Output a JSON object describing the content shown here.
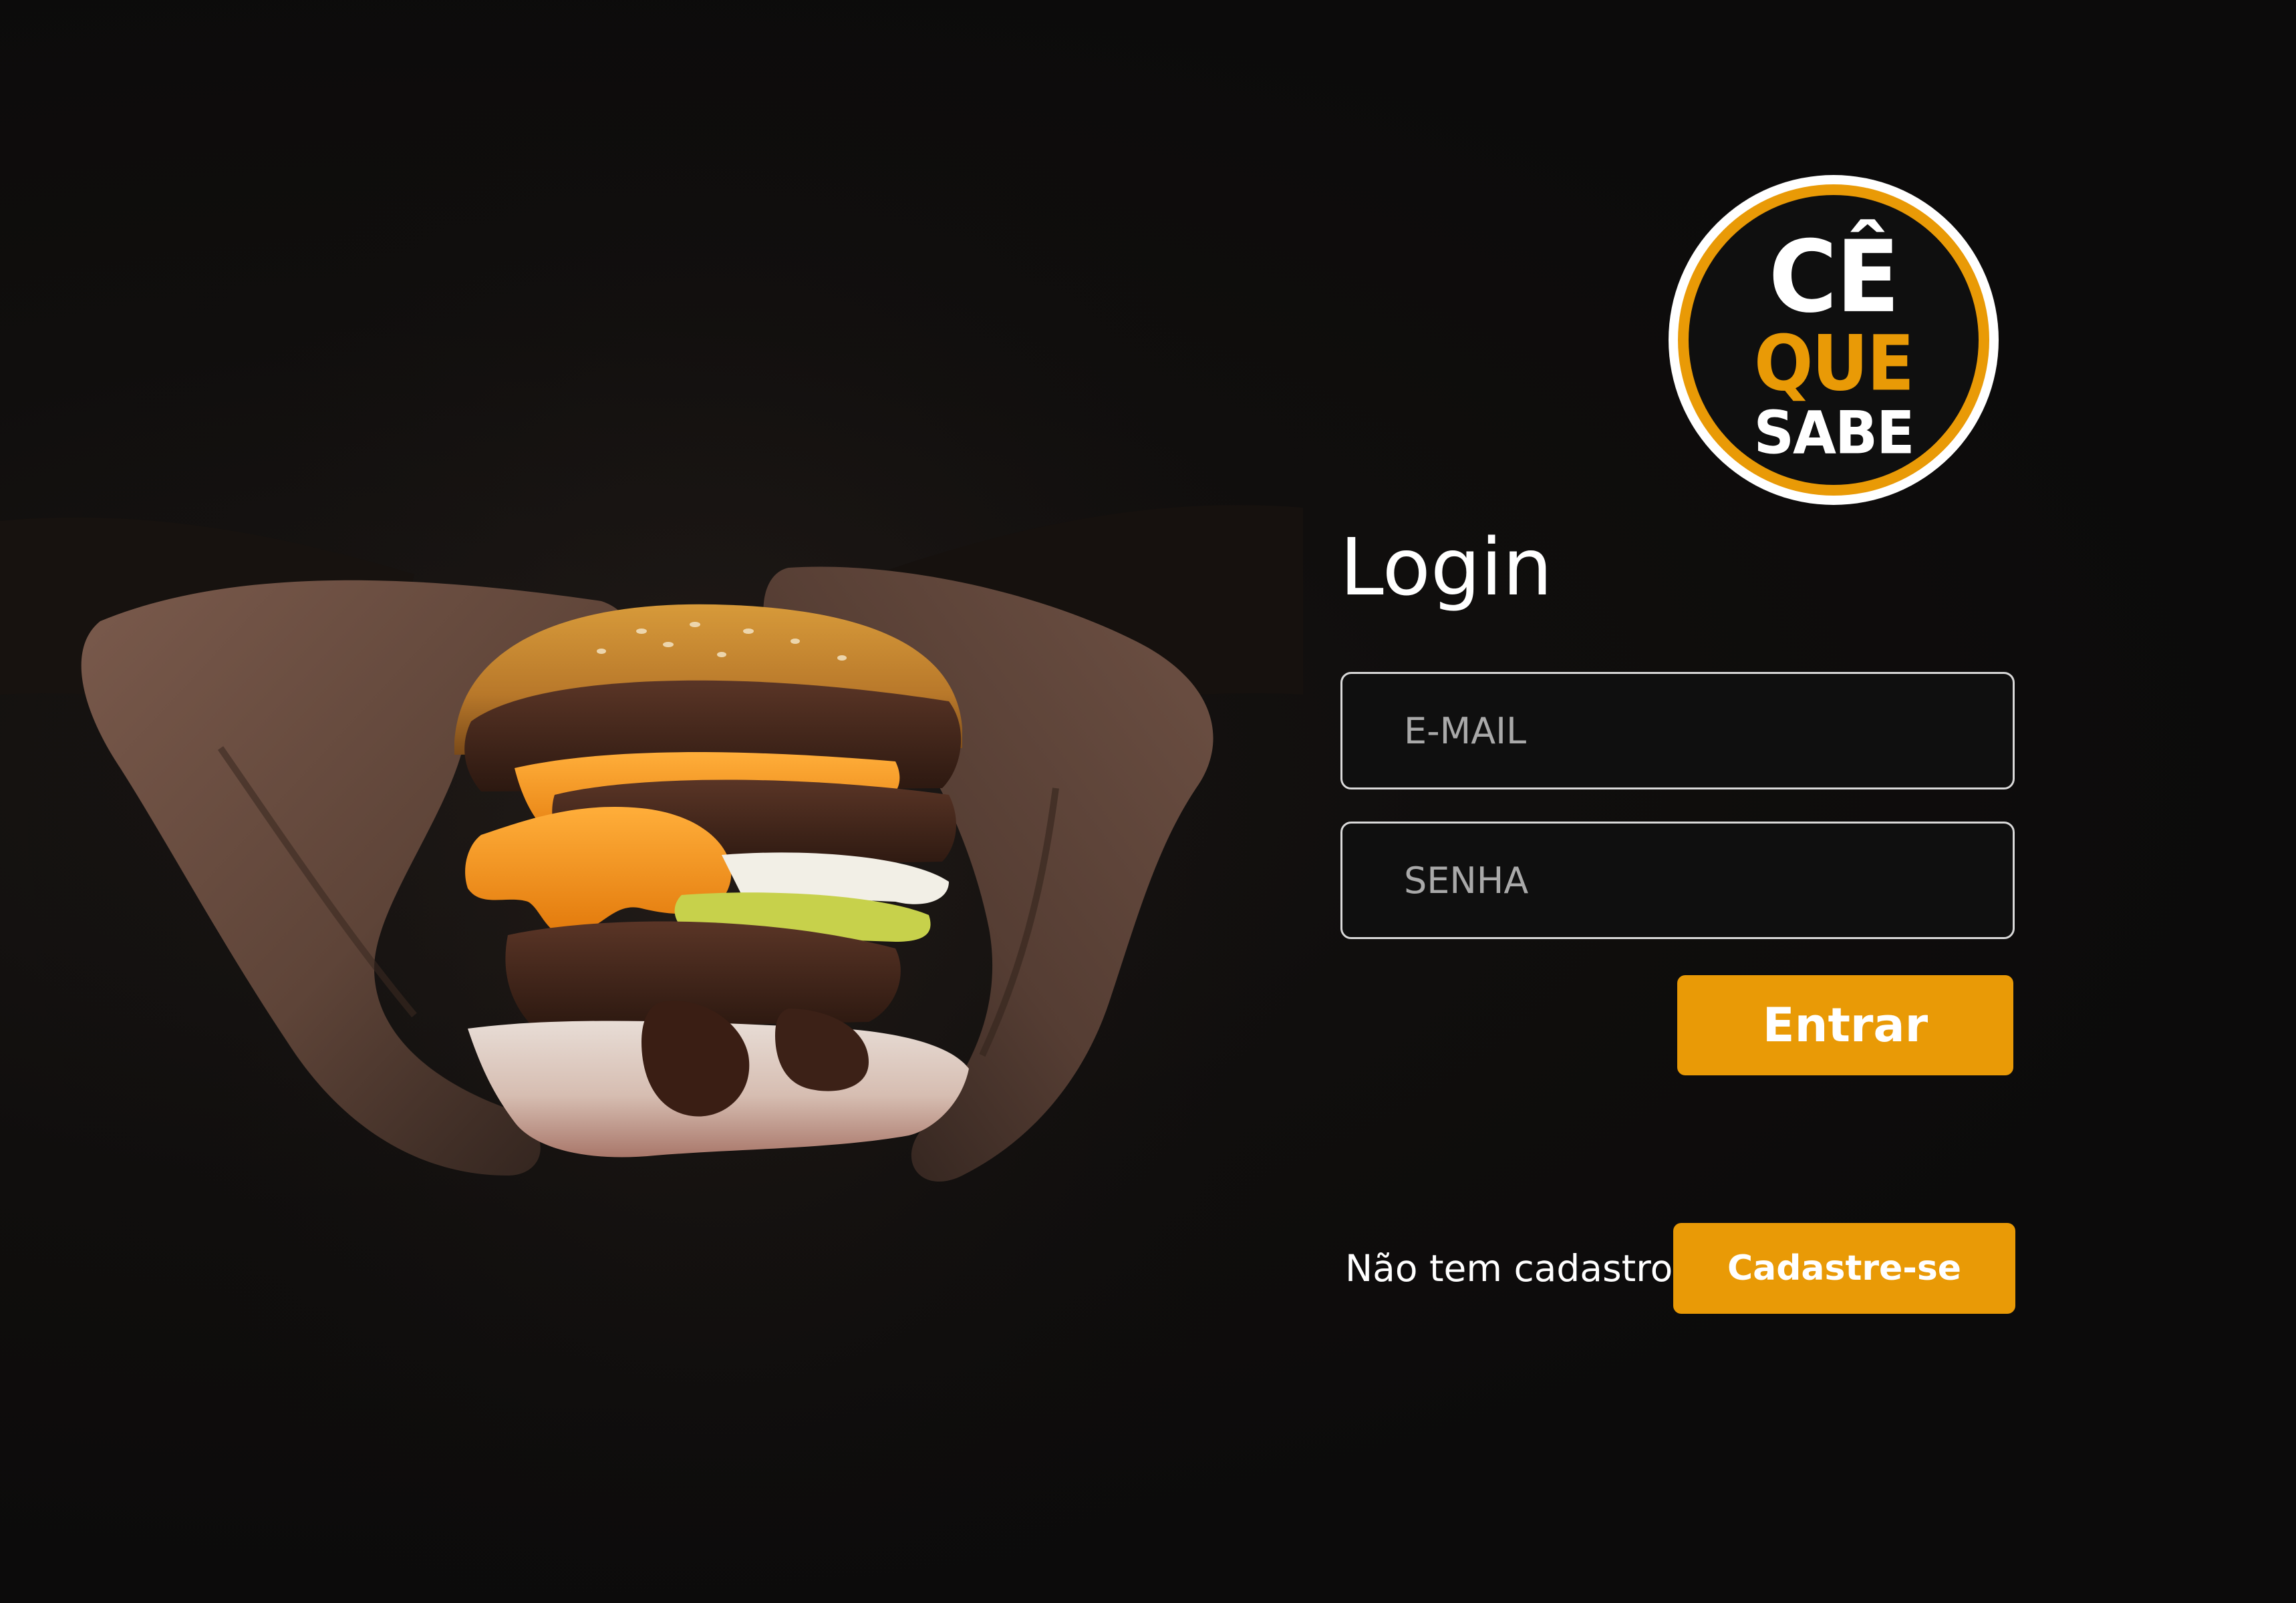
{
  "brand": {
    "logo_line1": "CÊ",
    "logo_line2": "QUE",
    "logo_line3": "SABE",
    "accent_color": "#e99a06",
    "background_color": "#0f0f0f"
  },
  "hero": {
    "image": "burger-held-in-hands-photo"
  },
  "login": {
    "title": "Login",
    "email_placeholder": "E-MAIL",
    "password_placeholder": "SENHA",
    "submit_label": "Entrar"
  },
  "signup": {
    "prompt": "Não tem cadastro?",
    "button_label": "Cadastre-se"
  }
}
